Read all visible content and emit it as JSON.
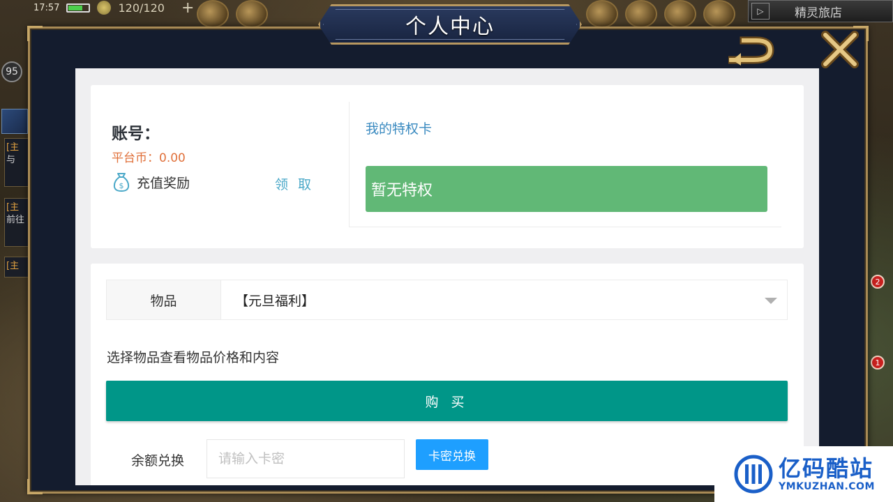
{
  "status_bar": {
    "time": "17:57",
    "stamina": "120/120",
    "add_symbol": "+"
  },
  "game_hud": {
    "level": "95",
    "shop_tab_label": "精灵旅店",
    "shop_tab_arrow": "▷",
    "quests": [
      {
        "tag": "[主",
        "text": "与"
      },
      {
        "tag": "[主",
        "text": "前往"
      },
      {
        "tag": "[主",
        "text": ""
      }
    ],
    "notification_counts": [
      "2",
      "1"
    ]
  },
  "modal": {
    "title": "个人中心"
  },
  "account": {
    "label": "账号：",
    "platform_coins": "平台币：0.00",
    "recharge_label": "充值奖励",
    "claim_label": "领 取"
  },
  "privilege": {
    "title": "我的特权卡",
    "status": "暂无特权"
  },
  "shop": {
    "item_label": "物品",
    "selected_item": "【元旦福利】",
    "hint": "选择物品查看物品价格和内容",
    "buy_label": "购 买",
    "redeem_label": "余额兑换",
    "redeem_placeholder": "请输入卡密",
    "redeem_button": "卡密兑换"
  },
  "watermark": {
    "name": "亿码酷站",
    "domain": "YMKUZHAN.COM"
  },
  "colors": {
    "teal_button": "#009688",
    "blue_button": "#1e9fff",
    "privilege_green": "#61b876",
    "coin_orange": "#e0703a",
    "link_blue": "#4aa8c8",
    "frame_gold": "#a88a55"
  }
}
